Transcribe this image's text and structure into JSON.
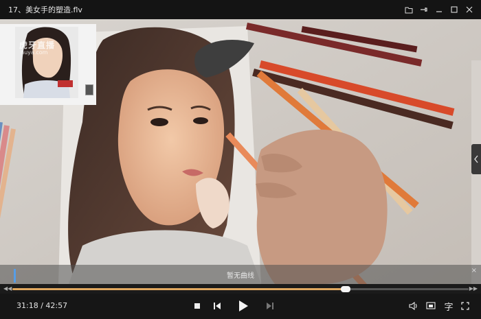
{
  "window": {
    "title": "17、美女手的塑造.flv",
    "icons": [
      "folder-icon",
      "pin-icon",
      "minimize-icon",
      "maximize-icon",
      "close-icon"
    ]
  },
  "pip": {
    "watermark": "虎牙直播",
    "watermark_url": "huya.com"
  },
  "curve": {
    "label": "暂无曲线",
    "close": "×"
  },
  "progress": {
    "current_fraction": 0.731
  },
  "controls": {
    "current_time": "31:18",
    "separator": " / ",
    "total_time": "42:57",
    "subtitle_label": "字"
  },
  "colors": {
    "progress_fill": "#e0a860",
    "background": "#161616"
  }
}
